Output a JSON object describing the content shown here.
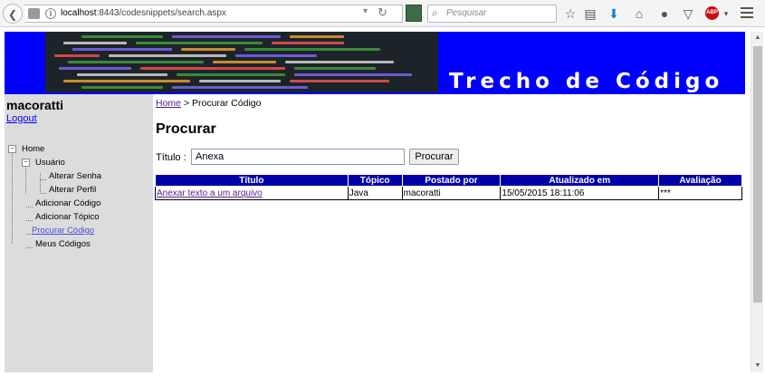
{
  "browser": {
    "url_host": "localhost",
    "url_path": ":8443/codesnippets/search.aspx",
    "search_placeholder": "Pesquisar",
    "abp_label": "ABP"
  },
  "banner": {
    "title": "Trecho de Código"
  },
  "sidebar": {
    "username": "macoratti",
    "logout": "Logout",
    "tree": {
      "home": "Home",
      "usuario": "Usuário",
      "alterar_senha": "Alterar Senha",
      "alterar_perfil": "Alterar Perfil",
      "adicionar_codigo": "Adicionar Código",
      "adicionar_topico": "Adicionar Tópico",
      "procurar_codigo": "Procurar Código",
      "meus_codigos": "Meus Códigos"
    }
  },
  "main": {
    "breadcrumb_home": "Home",
    "breadcrumb_sep": ">",
    "breadcrumb_current": "Procurar Código",
    "heading": "Procurar",
    "search_label": "Título :",
    "search_value": "Anexa",
    "search_button": "Procurar",
    "table": {
      "headers": [
        "Título",
        "Tópico",
        "Postado por",
        "Atualizado em",
        "Avaliação"
      ],
      "rows": [
        [
          "Anexar texto a um arquivo",
          "Java",
          "macoratti",
          "15/05/2015 18:11:06",
          "***"
        ]
      ]
    }
  }
}
